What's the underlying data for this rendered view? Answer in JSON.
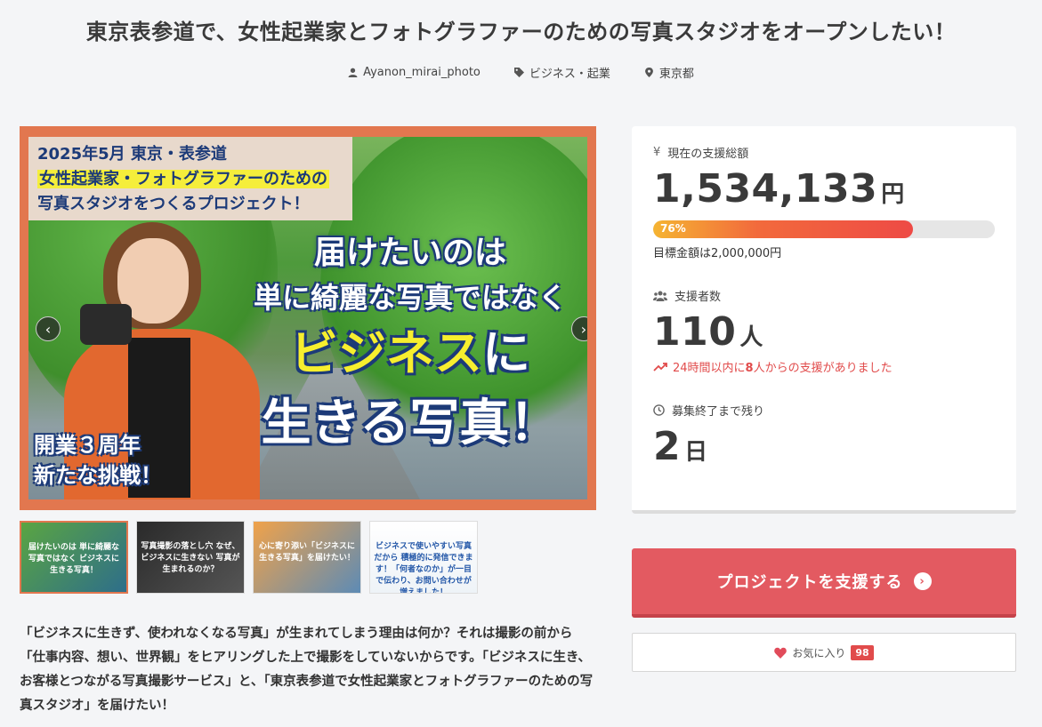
{
  "project": {
    "title": "東京表参道で、女性起業家とフォトグラファーのための写真スタジオをオープンしたい！",
    "owner": "Ayanon_mirai_photo",
    "category": "ビジネス・起業",
    "location": "東京都"
  },
  "hero_image": {
    "banner_line1": "2025年5月 東京・表参道",
    "banner_line2": "女性起業家・フォトグラファーのための",
    "banner_line3": "写真スタジオをつくるプロジェクト！",
    "catch_line1": "届けたいのは",
    "catch_line2": "単に綺麗な写真ではなく",
    "catch_line3_highlight": "ビジネス",
    "catch_line3_rest": "に",
    "catch_line4": "生きる写真！",
    "badge_line1": "開業３周年",
    "badge_line2": "新たな挑戦！",
    "prev_icon": "chevron-left",
    "next_icon": "chevron-right"
  },
  "thumbnails": [
    {
      "text": "届けたいのは 単に綺麗な写真ではなく ビジネスに 生きる写真！",
      "active": true
    },
    {
      "text": "写真撮影の落とし穴 なぜ、ビジネスに生きない 写真が生まれるのか？",
      "active": false
    },
    {
      "text": "心に寄り添い「ビジネスに生きる写真」を届けたい！",
      "active": false
    },
    {
      "text": "ビジネスで使いやすい写真だから 積極的に発信できます！「何者なのか」が一目で伝わり、お問い合わせが増えました！",
      "active": false
    }
  ],
  "description": "「ビジネスに生きず、使われなくなる写真」が生まれてしまう理由は何か？それは撮影の前から「仕事内容、想い、世界観」をヒアリングした上で撮影をしていないからです。「ビジネスに生き、お客様とつながる写真撮影サービス」と、「東京表参道で女性起業家とフォトグラファーのための写真スタジオ」を届けたい！",
  "stats": {
    "amount_label": "現在の支援総額",
    "amount_value": "1,534,133",
    "amount_unit": "円",
    "progress_percent": 76,
    "progress_text": "76%",
    "goal_text": "目標金額は2,000,000円",
    "supporters_label": "支援者数",
    "supporters_value": "110",
    "supporters_unit": "人",
    "recent_prefix": "24時間以内に",
    "recent_count": "8",
    "recent_suffix": "人からの支援がありました",
    "remaining_label": "募集終了まで残り",
    "remaining_value": "2",
    "remaining_unit": "日"
  },
  "cta": {
    "label": "プロジェクトを支援する"
  },
  "favorite": {
    "label": "お気に入り",
    "count": "98"
  },
  "colors": {
    "accent": "#e35a61",
    "alert": "#e14b4b",
    "image_frame": "#e2774f"
  }
}
